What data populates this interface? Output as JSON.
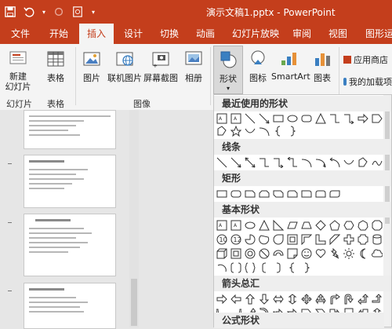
{
  "window": {
    "title": "演示文稿1.pptx - PowerPoint"
  },
  "tabs": [
    "文件",
    "开始",
    "插入",
    "设计",
    "切换",
    "动画",
    "幻灯片放映",
    "审阅",
    "视图",
    "图形运"
  ],
  "active_tab": "插入",
  "ribbon": {
    "new_slide": "新建\n幻灯片",
    "table": "表格",
    "picture": "图片",
    "online_picture": "联机图片",
    "screenshot": "屏幕截图",
    "album": "相册",
    "shapes": "形状",
    "icons": "图标",
    "smartart": "SmartArt",
    "chart": "图表",
    "app_store": "应用商店",
    "my_addins": "我的加载项",
    "group_slides": "幻灯片",
    "group_tables": "表格",
    "group_images": "图像"
  },
  "slides": [
    {
      "lines": 9
    },
    {
      "lines": 6
    },
    {
      "lines": 9
    },
    {
      "lines": 8
    }
  ],
  "gallery": {
    "sections": [
      "最近使用的形状",
      "线条",
      "矩形",
      "基本形状",
      "箭头总汇",
      "公式形状"
    ]
  },
  "colors": {
    "accent": "#c43e1c"
  }
}
